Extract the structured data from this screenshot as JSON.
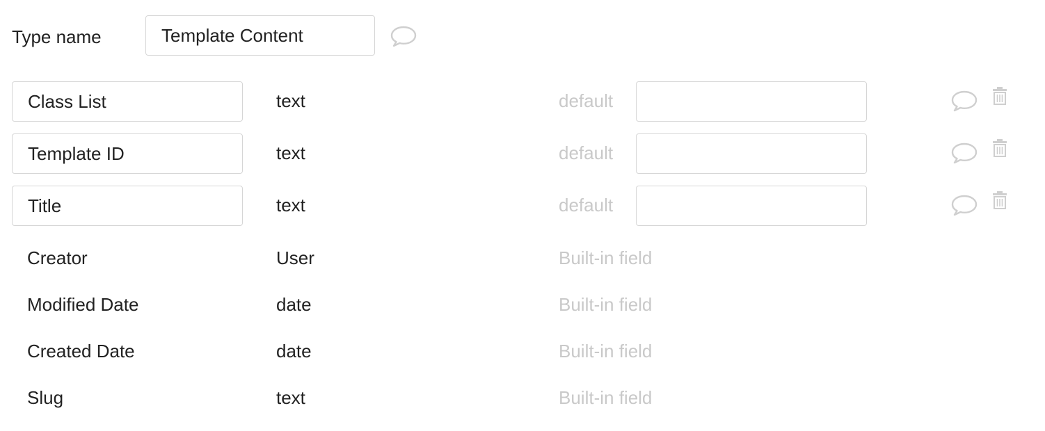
{
  "type_name": {
    "label": "Type name",
    "value": "Template Content"
  },
  "fields": [
    {
      "name": "Class List",
      "type": "text",
      "default_label": "default",
      "default_value": ""
    },
    {
      "name": "Template ID",
      "type": "text",
      "default_label": "default",
      "default_value": ""
    },
    {
      "name": "Title",
      "type": "text",
      "default_label": "default",
      "default_value": ""
    }
  ],
  "builtin_fields": [
    {
      "name": "Creator",
      "type": "User",
      "note": "Built-in field"
    },
    {
      "name": "Modified Date",
      "type": "date",
      "note": "Built-in field"
    },
    {
      "name": "Created Date",
      "type": "date",
      "note": "Built-in field"
    },
    {
      "name": "Slug",
      "type": "text",
      "note": "Built-in field"
    }
  ],
  "icons": {
    "comment": "speech-bubble-icon",
    "delete": "trash-icon"
  },
  "colors": {
    "text": "#222222",
    "muted_text": "#c9c9c9",
    "input_border": "#d6d6d6",
    "icon": "#cfcfcf"
  }
}
